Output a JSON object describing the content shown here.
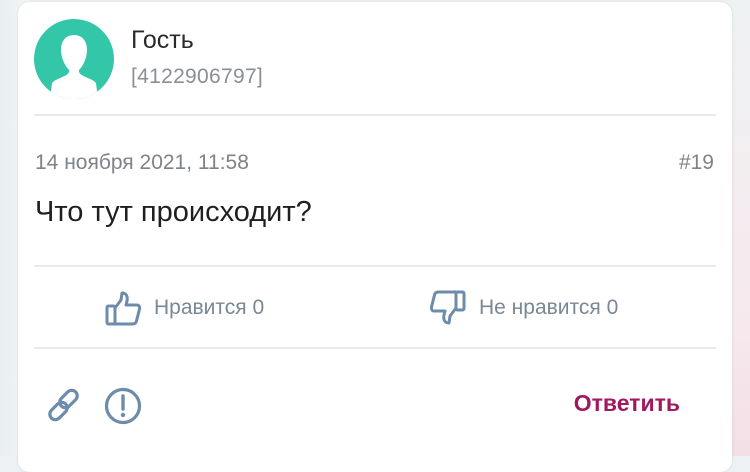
{
  "user": {
    "name": "Гость",
    "id": "[4122906797]"
  },
  "post": {
    "date": "14 ноября 2021, 11:58",
    "number": "#19",
    "text": "Что тут происходит?"
  },
  "votes": {
    "like_label": "Нравится 0",
    "dislike_label": "Не нравится 0"
  },
  "actions": {
    "reply_label": "Ответить"
  },
  "icons": {
    "avatar": "user-silhouette-icon",
    "like": "thumbs-up-icon",
    "dislike": "thumbs-down-icon",
    "link": "link-icon",
    "report": "exclamation-circle-icon"
  },
  "colors": {
    "avatar_bg": "#34c6a8",
    "icon_blue": "#6d8cab",
    "reply": "#a0195e",
    "muted_text": "#7d8389"
  }
}
